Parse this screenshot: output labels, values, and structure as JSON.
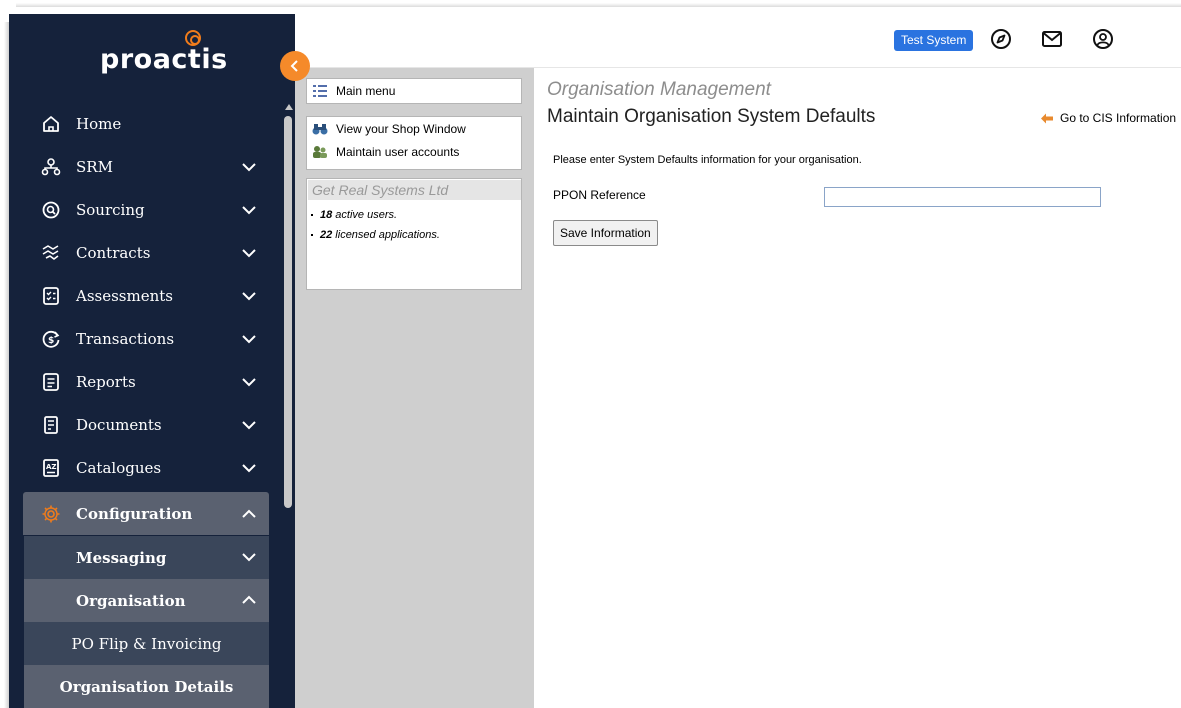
{
  "brand": {
    "name": "proactis",
    "accent": "#f07c1b"
  },
  "sidebar": {
    "items": [
      {
        "label": "Home",
        "icon": "home-icon"
      },
      {
        "label": "SRM",
        "icon": "srm-icon"
      },
      {
        "label": "Sourcing",
        "icon": "sourcing-icon"
      },
      {
        "label": "Contracts",
        "icon": "contracts-icon"
      },
      {
        "label": "Assessments",
        "icon": "assessments-icon"
      },
      {
        "label": "Transactions",
        "icon": "transactions-icon"
      },
      {
        "label": "Reports",
        "icon": "reports-icon"
      },
      {
        "label": "Documents",
        "icon": "documents-icon"
      },
      {
        "label": "Catalogues",
        "icon": "catalogues-icon"
      },
      {
        "label": "Configuration",
        "icon": "gear-icon"
      }
    ],
    "sub": {
      "messaging": "Messaging",
      "organisation": "Organisation",
      "po_flip": "PO Flip & Invoicing",
      "org_details": "Organisation Details"
    }
  },
  "topbar": {
    "badge": "Test System",
    "icons": [
      "compass-icon",
      "mail-icon",
      "user-icon"
    ]
  },
  "leftpanel": {
    "main_menu": "Main menu",
    "links": [
      "View your Shop Window",
      "Maintain user accounts"
    ],
    "org_name": "Get Real Systems Ltd",
    "stats": [
      {
        "count": "18",
        "text": " active users."
      },
      {
        "count": "22",
        "text": " licensed applications."
      }
    ]
  },
  "main": {
    "section": "Organisation Management",
    "title": "Maintain Organisation System Defaults",
    "cis_link": "Go to CIS Information",
    "intro": "Please enter System Defaults information for your organisation.",
    "field_label": "PPON Reference",
    "field_value": "",
    "save_label": "Save Information"
  }
}
